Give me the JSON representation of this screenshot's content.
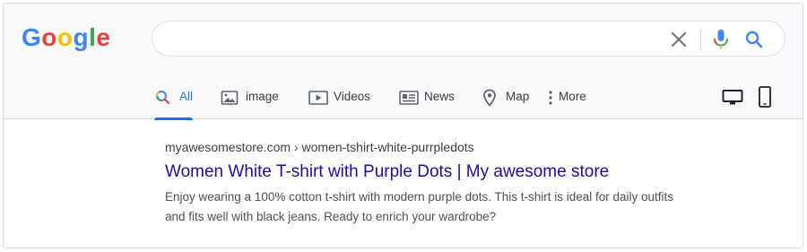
{
  "brand": {
    "logo_letters": [
      {
        "char": "G",
        "color": "#4285F4"
      },
      {
        "char": "o",
        "color": "#EA4335"
      },
      {
        "char": "o",
        "color": "#FBBC05"
      },
      {
        "char": "g",
        "color": "#4285F4"
      },
      {
        "char": "l",
        "color": "#34A853"
      },
      {
        "char": "e",
        "color": "#EA4335"
      }
    ]
  },
  "search": {
    "value": "",
    "placeholder": "",
    "clear_icon": "close-icon",
    "mic_icon": "microphone-icon",
    "search_icon": "search-icon"
  },
  "tabs": [
    {
      "label": "All",
      "icon": "search-icon",
      "active": true
    },
    {
      "label": "image",
      "icon": "image-icon",
      "active": false
    },
    {
      "label": "Videos",
      "icon": "video-icon",
      "active": false
    },
    {
      "label": "News",
      "icon": "news-icon",
      "active": false
    },
    {
      "label": "Map",
      "icon": "map-pin-icon",
      "active": false
    },
    {
      "label": "More",
      "icon": "more-vertical-icon",
      "active": false
    }
  ],
  "devices": {
    "desktop_icon": "desktop-icon",
    "mobile_icon": "mobile-icon"
  },
  "result": {
    "breadcrumb": "myawesomestore.com › women-tshirt-white-purrpledots",
    "title": "Women White T-shirt with Purple Dots | My awesome store",
    "snippet_line1": "Enjoy wearing a 100% cotton t-shirt with modern purple dots. This t-shirt is ideal for daily outfits",
    "snippet_line2": "and fits well with black jeans. Ready to enrich your wardrobe?"
  },
  "colors": {
    "accent": "#1a73e8",
    "link": "#1a0dab",
    "header_bg": "#f8f9fa"
  }
}
